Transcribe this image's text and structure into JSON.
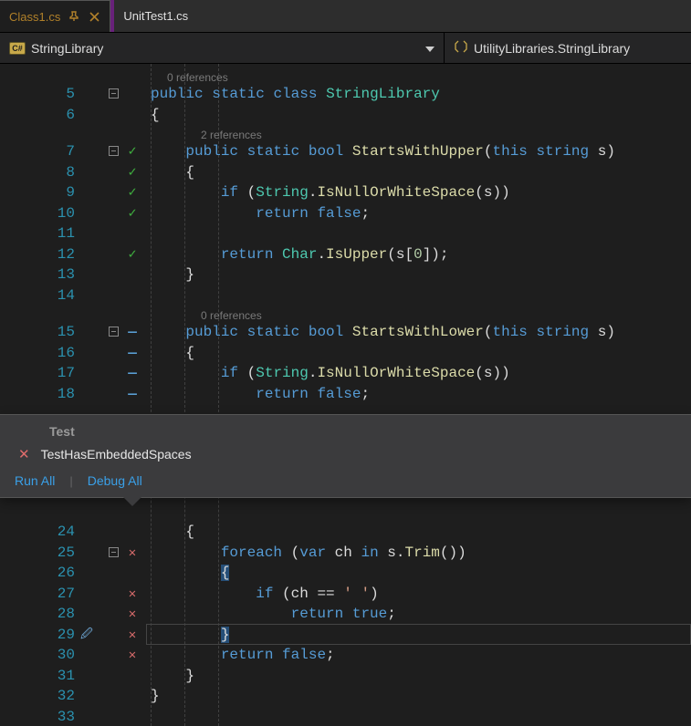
{
  "tabs": [
    {
      "label": "Class1.cs",
      "active": true,
      "pinned": true
    },
    {
      "label": "UnitTest1.cs",
      "active": false,
      "pinned": false
    }
  ],
  "navbar": {
    "left_icon_text": "C#",
    "left_text": "StringLibrary",
    "right_text": "UtilityLibraries.StringLibrary"
  },
  "codelens_popup": {
    "heading": "Test",
    "fail_icon": "✕",
    "test_name": "TestHasEmbeddedSpaces",
    "run_all": "Run All",
    "debug_all": "Debug All"
  },
  "refs": {
    "zero": "0 references",
    "two": "2 references"
  },
  "lines": {
    "l5": {
      "n": "5",
      "mk": "",
      "fold": true,
      "code": [
        [
          "kw",
          "public"
        ],
        [
          "pln",
          " "
        ],
        [
          "kw",
          "static"
        ],
        [
          "pln",
          " "
        ],
        [
          "kw",
          "class"
        ],
        [
          "pln",
          " "
        ],
        [
          "typ",
          "StringLibrary"
        ]
      ]
    },
    "l6": {
      "n": "6",
      "mk": "",
      "fold": false,
      "code": [
        [
          "pun",
          "{"
        ]
      ]
    },
    "r1": {
      "ref": "two"
    },
    "l7": {
      "n": "7",
      "mk": "chk",
      "fold": true,
      "code": [
        [
          "pln",
          "    "
        ],
        [
          "kw",
          "public"
        ],
        [
          "pln",
          " "
        ],
        [
          "kw",
          "static"
        ],
        [
          "pln",
          " "
        ],
        [
          "kw",
          "bool"
        ],
        [
          "pln",
          " "
        ],
        [
          "fn",
          "StartsWithUpper"
        ],
        [
          "pun",
          "("
        ],
        [
          "kw",
          "this"
        ],
        [
          "pln",
          " "
        ],
        [
          "kw",
          "string"
        ],
        [
          "pln",
          " s"
        ],
        [
          "pun",
          ")"
        ]
      ]
    },
    "l8": {
      "n": "8",
      "mk": "chk",
      "fold": false,
      "code": [
        [
          "pln",
          "    "
        ],
        [
          "pun",
          "{"
        ]
      ]
    },
    "l9": {
      "n": "9",
      "mk": "chk",
      "fold": false,
      "code": [
        [
          "pln",
          "        "
        ],
        [
          "kw",
          "if"
        ],
        [
          "pln",
          " "
        ],
        [
          "pun",
          "("
        ],
        [
          "typ",
          "String"
        ],
        [
          "pun",
          "."
        ],
        [
          "fn",
          "IsNullOrWhiteSpace"
        ],
        [
          "pun",
          "("
        ],
        [
          "pln",
          "s"
        ],
        [
          "pun",
          "))"
        ]
      ]
    },
    "l10": {
      "n": "10",
      "mk": "chk",
      "fold": false,
      "code": [
        [
          "pln",
          "            "
        ],
        [
          "kw",
          "return"
        ],
        [
          "pln",
          " "
        ],
        [
          "kw",
          "false"
        ],
        [
          "pun",
          ";"
        ]
      ]
    },
    "l11": {
      "n": "11",
      "mk": "",
      "fold": false,
      "code": []
    },
    "l12": {
      "n": "12",
      "mk": "chk",
      "fold": false,
      "code": [
        [
          "pln",
          "        "
        ],
        [
          "kw",
          "return"
        ],
        [
          "pln",
          " "
        ],
        [
          "typ",
          "Char"
        ],
        [
          "pun",
          "."
        ],
        [
          "fn",
          "IsUpper"
        ],
        [
          "pun",
          "("
        ],
        [
          "pln",
          "s"
        ],
        [
          "pun",
          "["
        ],
        [
          "num",
          "0"
        ],
        [
          "pun",
          "]);"
        ]
      ]
    },
    "l13": {
      "n": "13",
      "mk": "",
      "fold": false,
      "code": [
        [
          "pln",
          "    "
        ],
        [
          "pun",
          "}"
        ]
      ]
    },
    "l14": {
      "n": "14",
      "mk": "",
      "fold": false,
      "code": []
    },
    "r2": {
      "ref": "zero"
    },
    "l15": {
      "n": "15",
      "mk": "dash",
      "fold": true,
      "code": [
        [
          "pln",
          "    "
        ],
        [
          "kw",
          "public"
        ],
        [
          "pln",
          " "
        ],
        [
          "kw",
          "static"
        ],
        [
          "pln",
          " "
        ],
        [
          "kw",
          "bool"
        ],
        [
          "pln",
          " "
        ],
        [
          "fn",
          "StartsWithLower"
        ],
        [
          "pun",
          "("
        ],
        [
          "kw",
          "this"
        ],
        [
          "pln",
          " "
        ],
        [
          "kw",
          "string"
        ],
        [
          "pln",
          " s"
        ],
        [
          "pun",
          ")"
        ]
      ]
    },
    "l16": {
      "n": "16",
      "mk": "dash",
      "fold": false,
      "code": [
        [
          "pln",
          "    "
        ],
        [
          "pun",
          "{"
        ]
      ]
    },
    "l17": {
      "n": "17",
      "mk": "dash",
      "fold": false,
      "code": [
        [
          "pln",
          "        "
        ],
        [
          "kw",
          "if"
        ],
        [
          "pln",
          " "
        ],
        [
          "pun",
          "("
        ],
        [
          "typ",
          "String"
        ],
        [
          "pun",
          "."
        ],
        [
          "fn",
          "IsNullOrWhiteSpace"
        ],
        [
          "pun",
          "("
        ],
        [
          "pln",
          "s"
        ],
        [
          "pun",
          "))"
        ]
      ]
    },
    "l18": {
      "n": "18",
      "mk": "dash",
      "fold": false,
      "code": [
        [
          "pln",
          "            "
        ],
        [
          "kw",
          "return"
        ],
        [
          "pln",
          " "
        ],
        [
          "kw",
          "false"
        ],
        [
          "pun",
          ";"
        ]
      ]
    },
    "l24": {
      "n": "24",
      "mk": "",
      "fold": false,
      "code": [
        [
          "pln",
          "    "
        ],
        [
          "pun",
          "{"
        ]
      ]
    },
    "l25": {
      "n": "25",
      "mk": "x",
      "fold": true,
      "code": [
        [
          "pln",
          "        "
        ],
        [
          "kw",
          "foreach"
        ],
        [
          "pln",
          " "
        ],
        [
          "pun",
          "("
        ],
        [
          "kw",
          "var"
        ],
        [
          "pln",
          " ch "
        ],
        [
          "kw",
          "in"
        ],
        [
          "pln",
          " s"
        ],
        [
          "pun",
          "."
        ],
        [
          "fn",
          "Trim"
        ],
        [
          "pun",
          "())"
        ]
      ]
    },
    "l26": {
      "n": "26",
      "mk": "",
      "fold": false,
      "code": [
        [
          "pln",
          "        "
        ],
        [
          "sel",
          "{"
        ]
      ]
    },
    "l27": {
      "n": "27",
      "mk": "x",
      "fold": false,
      "code": [
        [
          "pln",
          "            "
        ],
        [
          "kw",
          "if"
        ],
        [
          "pln",
          " "
        ],
        [
          "pun",
          "("
        ],
        [
          "pln",
          "ch "
        ],
        [
          "pun",
          "=="
        ],
        [
          "pln",
          " "
        ],
        [
          "str",
          "' '"
        ],
        [
          "pun",
          ")"
        ]
      ]
    },
    "l28": {
      "n": "28",
      "mk": "x",
      "fold": false,
      "code": [
        [
          "pln",
          "                "
        ],
        [
          "kw",
          "return"
        ],
        [
          "pln",
          " "
        ],
        [
          "kw",
          "true"
        ],
        [
          "pun",
          ";"
        ]
      ]
    },
    "l29": {
      "n": "29",
      "mk": "x",
      "fold": false,
      "code": [
        [
          "pln",
          "        "
        ],
        [
          "sel",
          "}"
        ]
      ],
      "hl": true,
      "pip": true
    },
    "l30": {
      "n": "30",
      "mk": "x",
      "fold": false,
      "code": [
        [
          "pln",
          "        "
        ],
        [
          "kw",
          "return"
        ],
        [
          "pln",
          " "
        ],
        [
          "kw",
          "false"
        ],
        [
          "pun",
          ";"
        ]
      ]
    },
    "l31": {
      "n": "31",
      "mk": "",
      "fold": false,
      "code": [
        [
          "pln",
          "    "
        ],
        [
          "pun",
          "}"
        ]
      ]
    },
    "l32": {
      "n": "32",
      "mk": "",
      "fold": false,
      "code": [
        [
          "pun",
          "}"
        ]
      ]
    },
    "l33": {
      "n": "33",
      "mk": "",
      "fold": false,
      "code": []
    }
  },
  "top_order": [
    "r0",
    "l5",
    "l6",
    "r1",
    "l7",
    "l8",
    "l9",
    "l10",
    "l11",
    "l12",
    "l13",
    "l14",
    "r2",
    "l15",
    "l16",
    "l17",
    "l18"
  ],
  "bottom_order": [
    "l24",
    "l25",
    "l26",
    "l27",
    "l28",
    "l29",
    "l30",
    "l31",
    "l32",
    "l33"
  ]
}
